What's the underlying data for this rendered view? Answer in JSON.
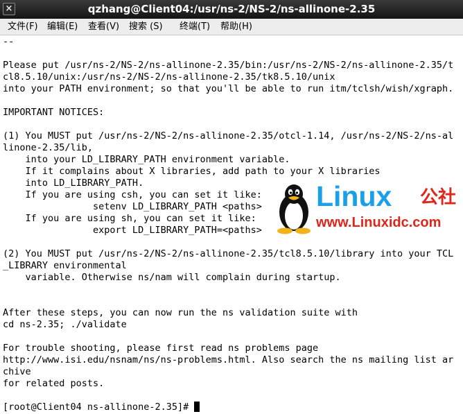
{
  "window": {
    "title": "qzhang@Client04:/usr/ns-2/NS-2/ns-allinone-2.35",
    "close_glyph": "×"
  },
  "menu": {
    "items": [
      {
        "label": "文件(F)"
      },
      {
        "label": "编辑(E)"
      },
      {
        "label": "查看(V)"
      },
      {
        "label": "搜索 (S)"
      },
      {
        "label": "终端(T)"
      },
      {
        "label": "帮助(H)"
      }
    ]
  },
  "terminal": {
    "output": "--\n\nPlease put /usr/ns-2/NS-2/ns-allinone-2.35/bin:/usr/ns-2/NS-2/ns-allinone-2.35/t\ncl8.5.10/unix:/usr/ns-2/NS-2/ns-allinone-2.35/tk8.5.10/unix\ninto your PATH environment; so that you'll be able to run itm/tclsh/wish/xgraph.\n\nIMPORTANT NOTICES:\n\n(1) You MUST put /usr/ns-2/NS-2/ns-allinone-2.35/otcl-1.14, /usr/ns-2/NS-2/ns-al\nlinone-2.35/lib,\n    into your LD_LIBRARY_PATH environment variable.\n    If it complains about X libraries, add path to your X libraries\n    into LD_LIBRARY_PATH.\n    If you are using csh, you can set it like:\n                setenv LD_LIBRARY_PATH <paths>\n    If you are using sh, you can set it like:\n                export LD_LIBRARY_PATH=<paths>\n\n(2) You MUST put /usr/ns-2/NS-2/ns-allinone-2.35/tcl8.5.10/library into your TCL\n_LIBRARY environmental\n    variable. Otherwise ns/nam will complain during startup.\n\n\nAfter these steps, you can now run the ns validation suite with\ncd ns-2.35; ./validate\n\nFor trouble shooting, please first read ns problems page\nhttp://www.isi.edu/nsnam/ns/ns-problems.html. Also search the ns mailing list ar\nchive\nfor related posts.\n\n",
    "prompt": "[root@Client04 ns-allinone-2.35]# "
  },
  "watermark": {
    "logo_text": "Linux",
    "logo_cn": "公社",
    "url": "www.Linuxidc.com",
    "icon": "penguin-icon"
  }
}
